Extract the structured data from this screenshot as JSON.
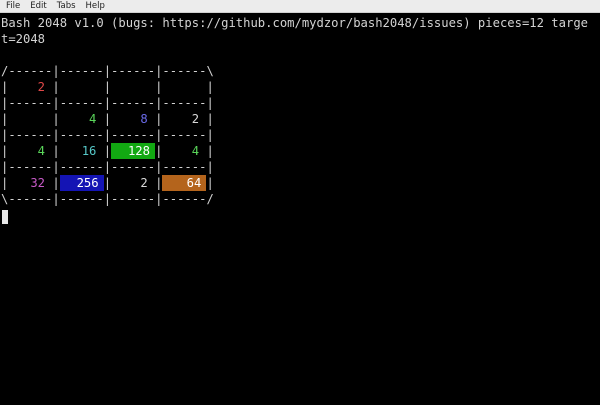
{
  "menubar": {
    "items": [
      "File",
      "Edit",
      "Tabs",
      "Help"
    ]
  },
  "terminal": {
    "header_line1": "Bash 2048 v1.0 (bugs: https://github.com/mydzor/bash2048/issues) pieces=12 targe",
    "header_line2": "t=2048",
    "border_top": "/------|------|------|------\\",
    "separator": "|------|------|------|------|",
    "border_bottom": "\\------|------|------|------/",
    "cell_row_frame": "|      |      |      |      |",
    "board": [
      [
        {
          "value": "2",
          "fg": "#e04848",
          "bg": ""
        },
        {
          "value": "",
          "fg": "",
          "bg": ""
        },
        {
          "value": "",
          "fg": "",
          "bg": ""
        },
        {
          "value": "",
          "fg": "",
          "bg": ""
        }
      ],
      [
        {
          "value": "",
          "fg": "",
          "bg": ""
        },
        {
          "value": "4",
          "fg": "#5ad65a",
          "bg": ""
        },
        {
          "value": "8",
          "fg": "#6a6ae8",
          "bg": ""
        },
        {
          "value": "2",
          "fg": "#d8d8d8",
          "bg": ""
        }
      ],
      [
        {
          "value": "4",
          "fg": "#5ad65a",
          "bg": ""
        },
        {
          "value": "16",
          "fg": "#56c8c8",
          "bg": ""
        },
        {
          "value": "128",
          "fg": "#ffffff",
          "bg": "#12a812"
        },
        {
          "value": "4",
          "fg": "#5ad65a",
          "bg": ""
        }
      ],
      [
        {
          "value": "32",
          "fg": "#c75ac7",
          "bg": ""
        },
        {
          "value": "256",
          "fg": "#ffffff",
          "bg": "#1414b4"
        },
        {
          "value": "2",
          "fg": "#d8d8d8",
          "bg": ""
        },
        {
          "value": "64",
          "fg": "#ffffff",
          "bg": "#b4641c"
        }
      ]
    ],
    "colors": {
      "background": "#000000",
      "text": "#d3d3d3",
      "cursor": "#e8e8e8"
    }
  }
}
